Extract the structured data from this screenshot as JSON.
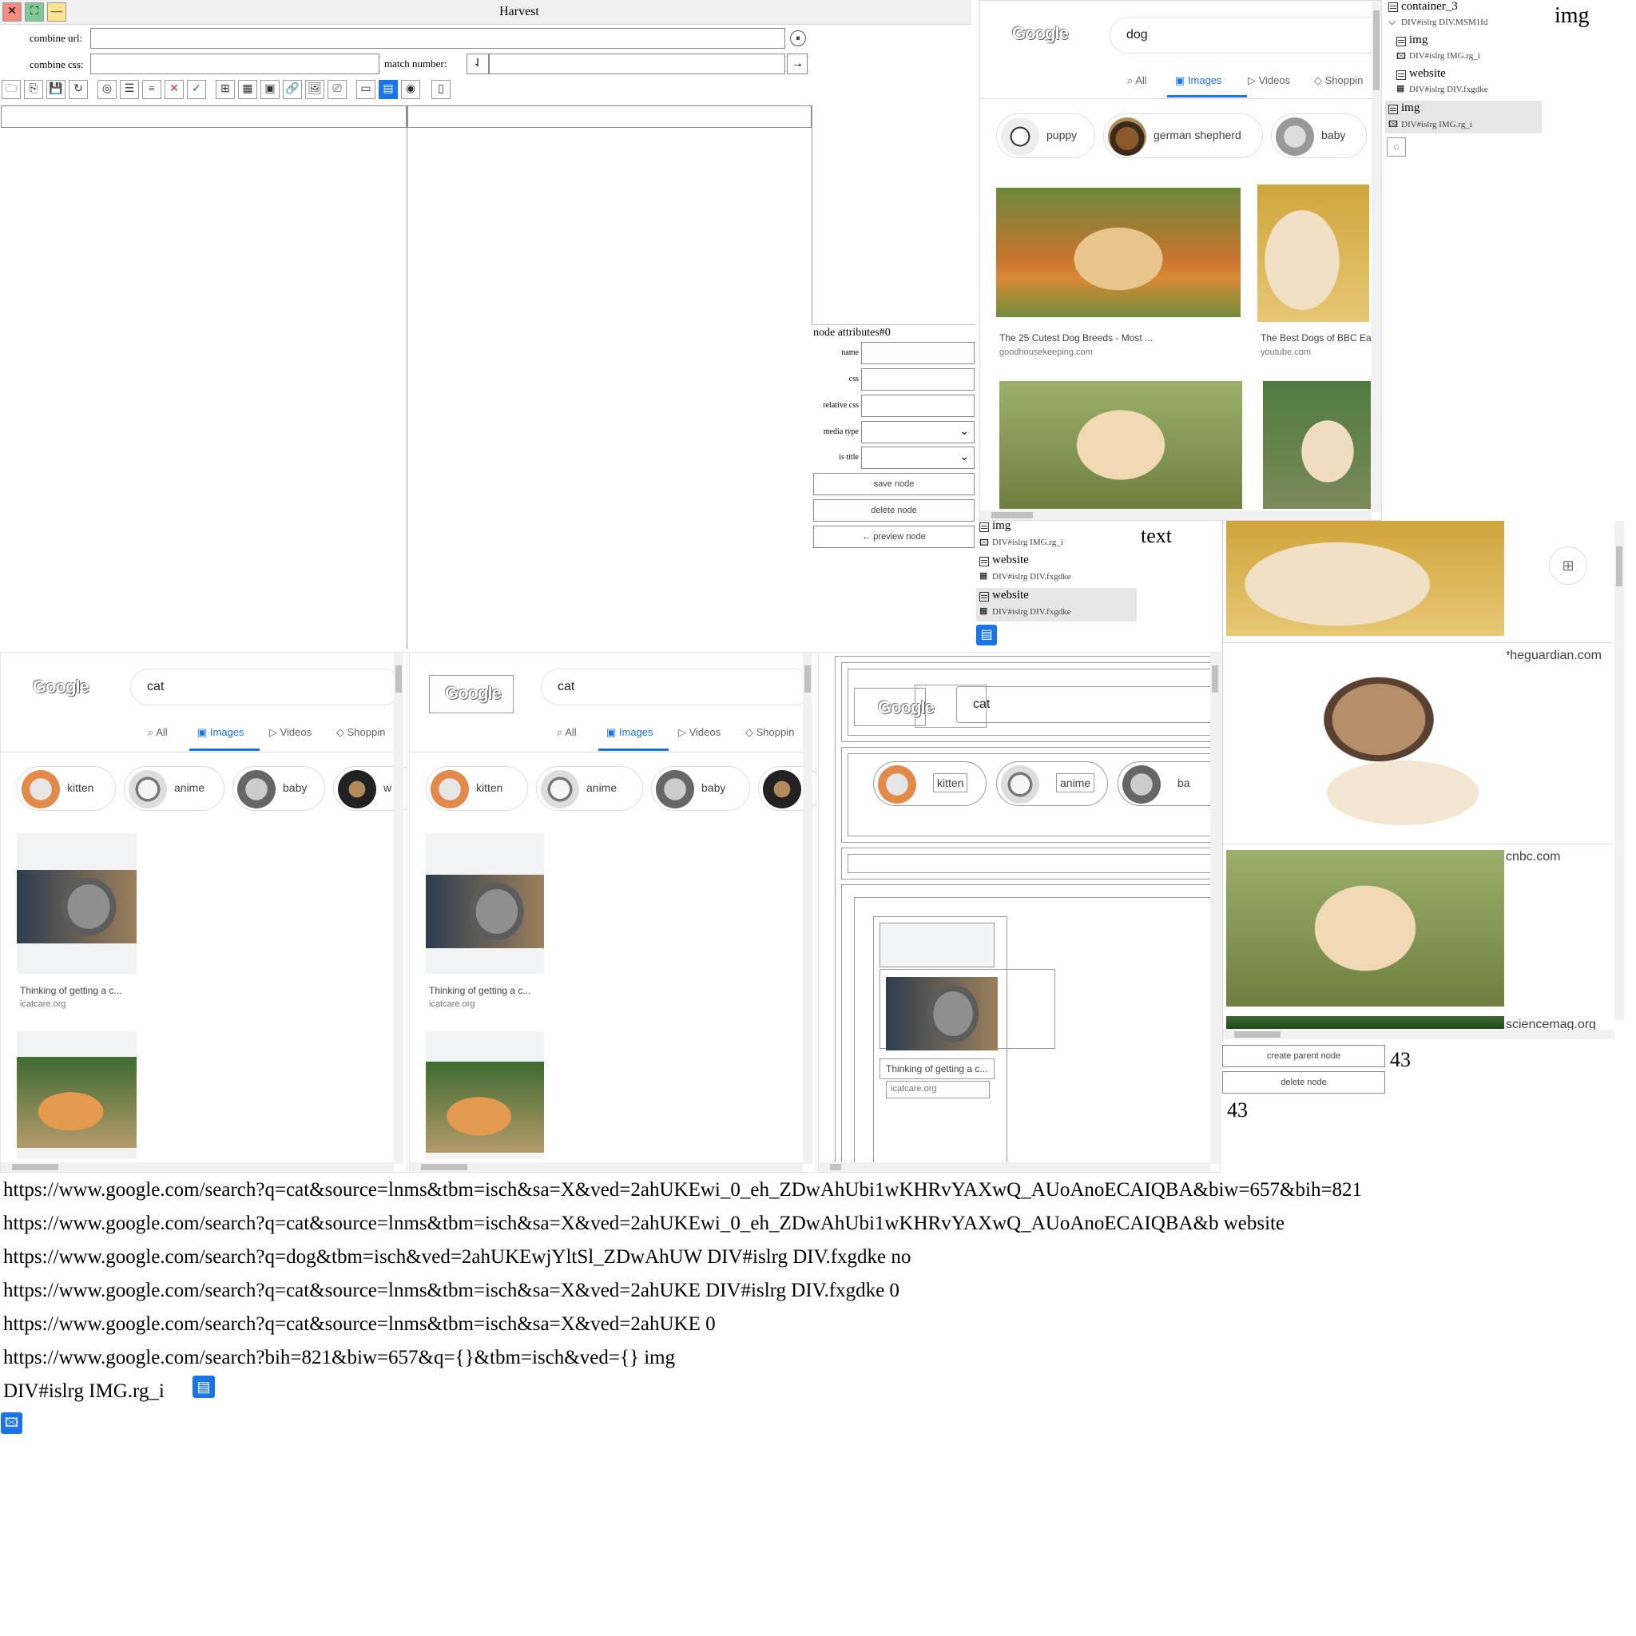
{
  "window": {
    "title": "Harvest",
    "close_icon": "close-icon",
    "fullscreen_icon": "fullscreen-icon",
    "minimize_icon": "minimize-icon"
  },
  "form": {
    "combine_url_label": "combine url:",
    "combine_css_label": "combine css:",
    "match_number_label": "match number:",
    "combine_url_value": "",
    "combine_css_value": "",
    "match_number_value": ""
  },
  "toolbar": {
    "icons": [
      "open-folder-icon",
      "new-file-icon",
      "save-icon",
      "refresh-icon",
      "target-icon",
      "list-icon",
      "list-alt-icon",
      "close-red-icon",
      "check-green-icon",
      "tree-icon",
      "table-icon",
      "form-icon",
      "link-icon",
      "image-icon",
      "media-icon",
      "window-icon",
      "layout-icon",
      "eye-icon",
      "mobile-icon"
    ]
  },
  "node_attributes": {
    "header": "node attributes#0",
    "name_label": "name",
    "css_label": "css",
    "relative_css_label": "relative css",
    "media_type_label": "media type",
    "is_title_label": "is title",
    "save_button": "save node",
    "delete_button": "delete node",
    "preview_button": "← preview node"
  },
  "dog_panel": {
    "query": "dog",
    "tabs": [
      "All",
      "Images",
      "Videos",
      "Shoppin"
    ],
    "chips": [
      "puppy",
      "german shepherd",
      "baby"
    ],
    "results": [
      {
        "caption": "The 25 Cutest Dog Breeds - Most ...",
        "source": "goodhousekeeping.com"
      },
      {
        "caption": "The Best Dogs of BBC Ea",
        "source": "youtube.com"
      }
    ]
  },
  "tree_top": {
    "items": [
      {
        "name": "container_3",
        "path": "DIV#islrg DIV.MSM1fd"
      },
      {
        "name": "img",
        "path": "DIV#islrg IMG.rg_i"
      },
      {
        "name": "website",
        "path": "DIV#islrg DIV.fxgdke"
      },
      {
        "name": "img",
        "path": "DIV#islrg IMG.rg_i"
      }
    ],
    "side_label": "img"
  },
  "tree_mid": {
    "items": [
      {
        "name": "img",
        "path": "DIV#islrg IMG.rg_i"
      },
      {
        "name": "website",
        "path": "DIV#islrg DIV.fxgdke"
      },
      {
        "name": "website",
        "path": "DIV#islrg DIV.fxgdke"
      }
    ],
    "side_label": "text"
  },
  "preview_panel": {
    "sources": [
      "theguardian.com",
      "cnbc.com",
      "sciencemag.org"
    ],
    "create_parent_button": "create parent node",
    "delete_button": "delete node",
    "count_a": "43",
    "count_b": "43"
  },
  "cat_panel_1": {
    "query": "cat",
    "tabs": [
      "All",
      "Images",
      "Videos",
      "Shoppin"
    ],
    "chips": [
      "kitten",
      "anime",
      "baby",
      "w"
    ],
    "caption": "Thinking of getting a c...",
    "source": "icatcare.org"
  },
  "cat_panel_2": {
    "query": "cat",
    "tabs": [
      "All",
      "Images",
      "Videos",
      "Shoppin"
    ],
    "chips": [
      "kitten",
      "anime",
      "baby"
    ],
    "caption": "Thinking of getting a c...",
    "source": "icatcare.org"
  },
  "cat_panel_3": {
    "query": "cat",
    "chips": [
      "kitten",
      "anime",
      "ba"
    ],
    "caption": "Thinking of getting a c...",
    "source": "icatcare.org"
  },
  "bottom_lines": [
    "https://www.google.com/search?q=cat&source=lnms&tbm=isch&sa=X&ved=2ahUKEwi_0_eh_ZDwAhUbi1wKHRvYAXwQ_AUoAnoECAIQBA&biw=657&bih=821",
    "https://www.google.com/search?q=cat&source=lnms&tbm=isch&sa=X&ved=2ahUKEwi_0_eh_ZDwAhUbi1wKHRvYAXwQ_AUoAnoECAIQBA&b website",
    "https://www.google.com/search?q=dog&tbm=isch&ved=2ahUKEwjYltSl_ZDwAhUW  DIV#islrg DIV.fxgdke  no",
    "https://www.google.com/search?q=cat&source=lnms&tbm=isch&sa=X&ved=2ahUKE  DIV#islrg DIV.fxgdke  0",
    "https://www.google.com/search?q=cat&source=lnms&tbm=isch&sa=X&ved=2ahUKE  0",
    "https://www.google.com/search?bih=821&biw=657&q={}&tbm=isch&ved={}  img",
    "DIV#islrg IMG.rg_i"
  ],
  "colors": {
    "accent": "#1a73e8",
    "close": "#f28b82",
    "fullscreen": "#81c995",
    "minimize": "#fde293"
  }
}
